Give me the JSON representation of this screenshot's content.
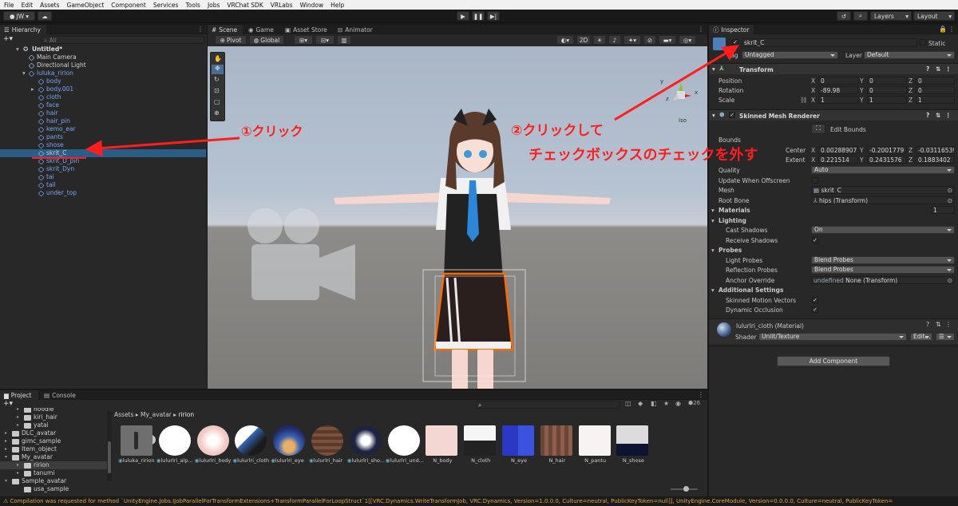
{
  "menu": [
    "File",
    "Edit",
    "Assets",
    "GameObject",
    "Component",
    "Services",
    "Tools",
    "Jobs",
    "VRChat SDK",
    "VRLabs",
    "Window",
    "Help"
  ],
  "toolbar": {
    "account": "JW",
    "layers": "Layers",
    "layout": "Layout"
  },
  "hierarchy": {
    "tab": "Hierarchy",
    "search_placeholder": "All",
    "scene": "Untitled*",
    "items": [
      {
        "label": "Main Camera",
        "depth": 1,
        "color": "white"
      },
      {
        "label": "Directional Light",
        "depth": 1,
        "color": "white"
      },
      {
        "label": "luluka_ririon",
        "depth": 1,
        "color": "blue"
      },
      {
        "label": "body",
        "depth": 2,
        "color": "blue"
      },
      {
        "label": "body.001",
        "depth": 2,
        "color": "blue"
      },
      {
        "label": "cloth",
        "depth": 2,
        "color": "blue"
      },
      {
        "label": "face",
        "depth": 2,
        "color": "blue"
      },
      {
        "label": "hair",
        "depth": 2,
        "color": "blue"
      },
      {
        "label": "hair_pin",
        "depth": 2,
        "color": "blue"
      },
      {
        "label": "kemo_ear",
        "depth": 2,
        "color": "blue"
      },
      {
        "label": "pants",
        "depth": 2,
        "color": "blue"
      },
      {
        "label": "shose",
        "depth": 2,
        "color": "blue"
      },
      {
        "label": "skrit_C",
        "depth": 2,
        "color": "white",
        "selected": true
      },
      {
        "label": "skrit_D_pin",
        "depth": 2,
        "color": "blue"
      },
      {
        "label": "skrit_Dyn",
        "depth": 2,
        "color": "blue"
      },
      {
        "label": "tai",
        "depth": 2,
        "color": "blue"
      },
      {
        "label": "tail",
        "depth": 2,
        "color": "blue"
      },
      {
        "label": "under_top",
        "depth": 2,
        "color": "blue"
      }
    ]
  },
  "scene_tabs": [
    {
      "label": "Scene"
    },
    {
      "label": "Game"
    },
    {
      "label": "Asset Store"
    },
    {
      "label": "Animator"
    }
  ],
  "scene_toolbar": {
    "pivot": "Pivot",
    "global": "Global",
    "mode_2d": "2D"
  },
  "gizmo": {
    "persp": "Iso",
    "axes": [
      "y",
      "x",
      "z"
    ]
  },
  "annotations": {
    "step1": "①クリック",
    "step2_line1": "②クリックして",
    "step2_line2": "チェックボックスのチェックを外す"
  },
  "inspector": {
    "tab": "Inspector",
    "name": "skrit_C",
    "static": "Static",
    "tag_label": "Tag",
    "tag": "Untagged",
    "layer_label": "Layer",
    "layer": "Default",
    "transform": {
      "title": "Transform",
      "position": {
        "label": "Position",
        "x": "0",
        "y": "0",
        "z": "0"
      },
      "rotation": {
        "label": "Rotation",
        "x": "-89.98",
        "y": "0",
        "z": "0"
      },
      "scale": {
        "label": "Scale",
        "x": "1",
        "y": "1",
        "z": "1"
      }
    },
    "smr": {
      "title": "Skinned Mesh Renderer",
      "edit_bounds": "Edit Bounds",
      "bounds": "Bounds",
      "center": {
        "label": "Center",
        "x": "0.00288907",
        "y": "-0.2001779",
        "z": "-0.03116539"
      },
      "extent": {
        "label": "Extent",
        "x": "0.221514",
        "y": "0.2431576",
        "z": "0.1883402"
      },
      "quality": {
        "label": "Quality",
        "value": "Auto"
      },
      "update_offscreen": "Update When Offscreen",
      "mesh": {
        "label": "Mesh",
        "value": "skrit_C"
      },
      "root_bone": {
        "label": "Root Bone",
        "value": "hips (Transform)"
      },
      "materials": {
        "label": "Materials",
        "value": "1"
      },
      "lighting": "Lighting",
      "cast_shadows": {
        "label": "Cast Shadows",
        "value": "On"
      },
      "receive_shadows": "Receive Shadows",
      "probes": "Probes",
      "light_probes": {
        "label": "Light Probes",
        "value": "Blend Probes"
      },
      "reflection_probes": {
        "label": "Reflection Probes",
        "value": "Blend Probes"
      },
      "anchor_override": {
        "label": "Anchor Override",
        "value": "None (Transform)"
      },
      "additional": "Additional Settings",
      "motion_vectors": "Skinned Motion Vectors",
      "dynamic_occlusion": "Dynamic Occlusion"
    },
    "material": {
      "name": "lulurlri_cloth (Material)",
      "shader_label": "Shader",
      "shader": "Unlit/Texture",
      "edit": "Edit..."
    },
    "add_component": "Add Component"
  },
  "project": {
    "tab": "Project",
    "console_tab": "Console",
    "count": "26",
    "breadcrumb": [
      "Assets",
      "My_avatar",
      "ririon"
    ],
    "tree": [
      {
        "label": "hoodie",
        "depth": 2
      },
      {
        "label": "kiri_hair",
        "depth": 2
      },
      {
        "label": "yatai",
        "depth": 2
      },
      {
        "label": "DLC_avatar",
        "depth": 1
      },
      {
        "label": "gimc_sample",
        "depth": 1
      },
      {
        "label": "Item_object",
        "depth": 1
      },
      {
        "label": "My_avatar",
        "depth": 1
      },
      {
        "label": "ririon",
        "depth": 2,
        "selected": true
      },
      {
        "label": "tanumi",
        "depth": 2
      },
      {
        "label": "Sample_avatar",
        "depth": 1
      },
      {
        "label": "usa_sample",
        "depth": 2
      }
    ],
    "assets": [
      {
        "label": "luluka_ririon",
        "kind": "model"
      },
      {
        "label": "lulurlri_alp...",
        "kind": "white"
      },
      {
        "label": "lulurlri_body",
        "kind": "skin"
      },
      {
        "label": "lulurlri_cloth",
        "kind": "cloth"
      },
      {
        "label": "lulurlri_eye",
        "kind": "eye"
      },
      {
        "label": "lulurlri_hair",
        "kind": "hair"
      },
      {
        "label": "lulurlri_sho...",
        "kind": "shoe"
      },
      {
        "label": "lulurlri_und...",
        "kind": "white"
      },
      {
        "label": "N_body",
        "kind": "nbody"
      },
      {
        "label": "N_cloth",
        "kind": "ncloth"
      },
      {
        "label": "N_eye",
        "kind": "neye"
      },
      {
        "label": "N_hair",
        "kind": "nhair"
      },
      {
        "label": "N_pantu",
        "kind": "npantu"
      },
      {
        "label": "N_shose",
        "kind": "nshose"
      }
    ]
  },
  "status": "Compilation was requested for method `UnityEngine.Jobs.IJobParallelForTransformExtensions+TransformParallelForLoopStruct`1[[VRC.Dynamics.WriteTransformJob, VRC.Dynamics, Version=1.0.0.0, Culture=neutral, PublicKeyToken=null]], UnityEngine.CoreModule, Version=0.0.0.0, Culture=neutral, PublicKeyToken=",
  "colors": {
    "annotation": "#ff1d1d",
    "selection": "#2c5d87",
    "sky": "#a8b8cd"
  }
}
